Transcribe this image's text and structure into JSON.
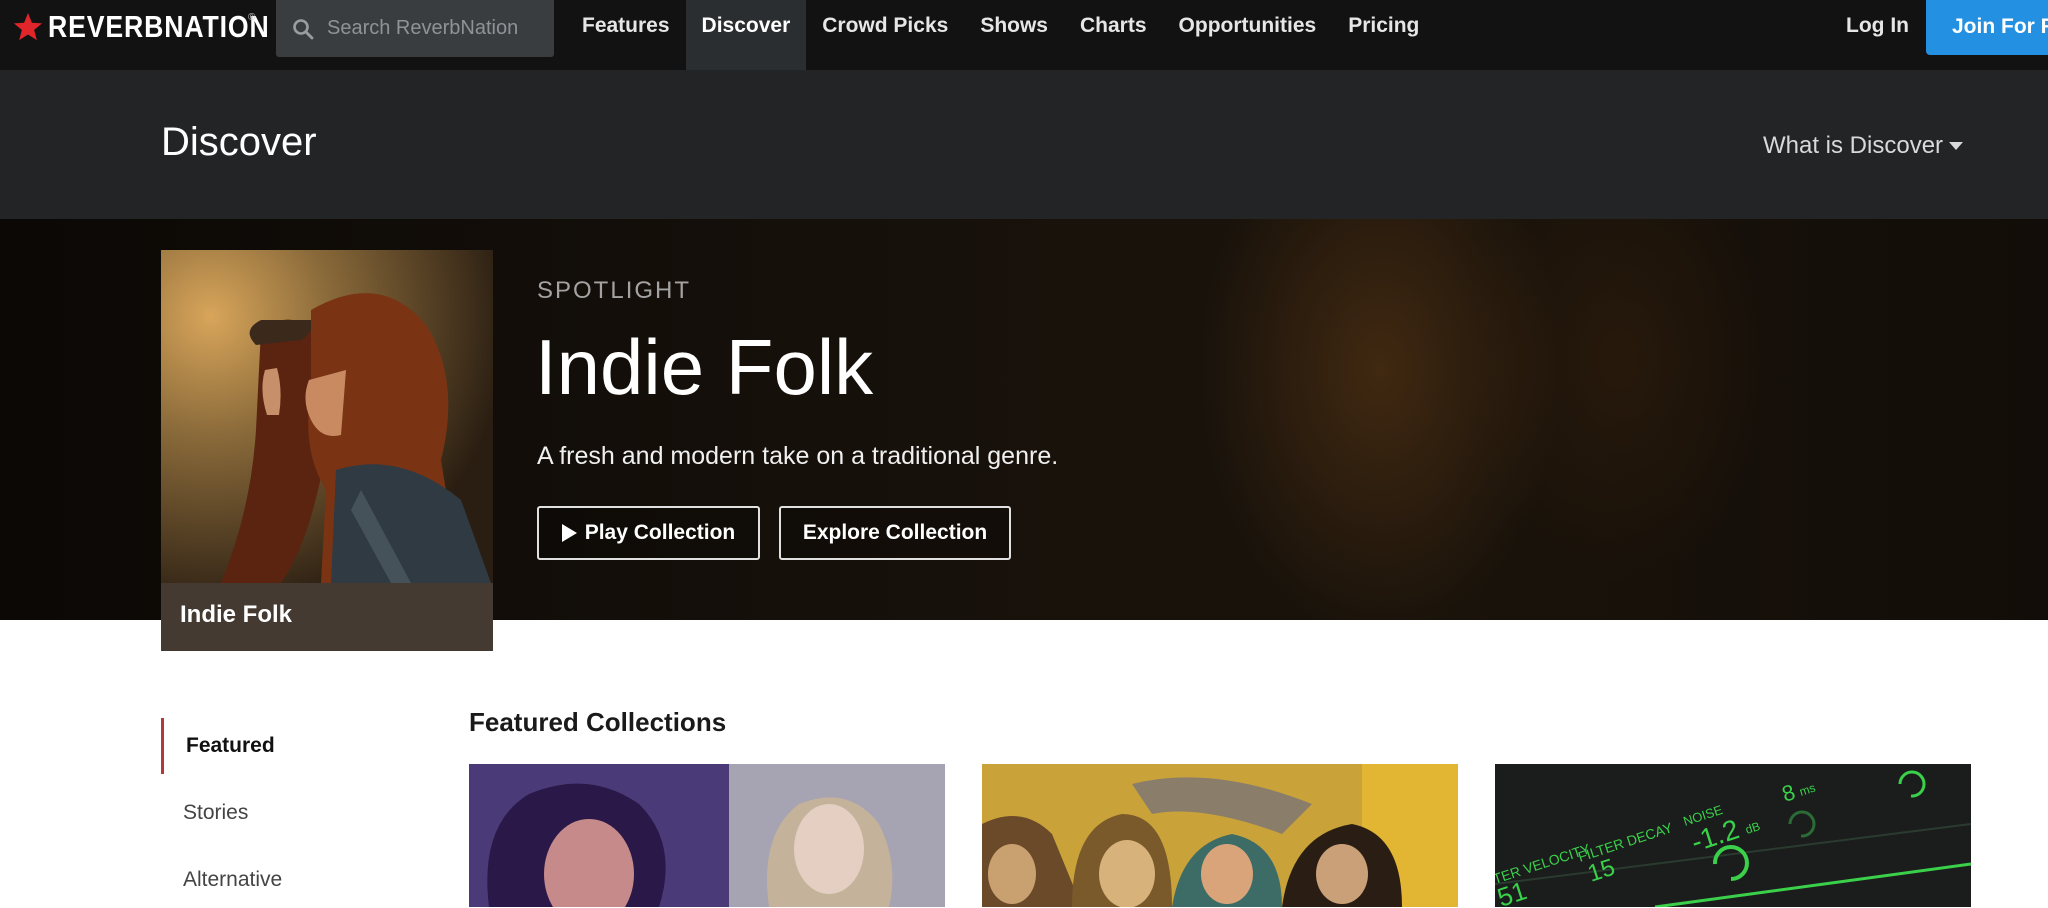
{
  "brand": {
    "name": "REVERBNATION",
    "mark": "®"
  },
  "search": {
    "placeholder": "Search ReverbNation"
  },
  "nav": {
    "items": [
      {
        "label": "Features"
      },
      {
        "label": "Discover",
        "active": true
      },
      {
        "label": "Crowd Picks"
      },
      {
        "label": "Shows"
      },
      {
        "label": "Charts"
      },
      {
        "label": "Opportunities"
      },
      {
        "label": "Pricing"
      }
    ],
    "login_label": "Log In",
    "join_label": "Join For F"
  },
  "header": {
    "title": "Discover",
    "what_is_label": "What is Discover"
  },
  "spotlight": {
    "kicker": "SPOTLIGHT",
    "title": "Indie Folk",
    "description": "A fresh and modern take on a traditional genre.",
    "cover_label": "Indie Folk",
    "play_label": "Play Collection",
    "explore_label": "Explore Collection"
  },
  "sidebar": {
    "items": [
      {
        "label": "Featured",
        "active": true
      },
      {
        "label": "Stories"
      },
      {
        "label": "Alternative"
      }
    ]
  },
  "featured": {
    "title": "Featured Collections",
    "cards": [
      {
        "image": "two-women-portrait"
      },
      {
        "image": "crowd-on-yellow"
      },
      {
        "image": "synth-display",
        "labels": [
          "TER VELOCITY",
          "FILTER DECAY",
          "NOISE",
          "51",
          "15",
          "-1.2",
          "dB",
          "8",
          "ms"
        ]
      }
    ]
  },
  "colors": {
    "accent": "#2390e2",
    "active_marker": "#b03a3a",
    "nav_bg": "#121212",
    "header_bg": "#222425"
  },
  "icons": {
    "logo": "star-icon",
    "search": "search-icon",
    "dropdown": "caret-down-icon",
    "play": "play-icon"
  }
}
